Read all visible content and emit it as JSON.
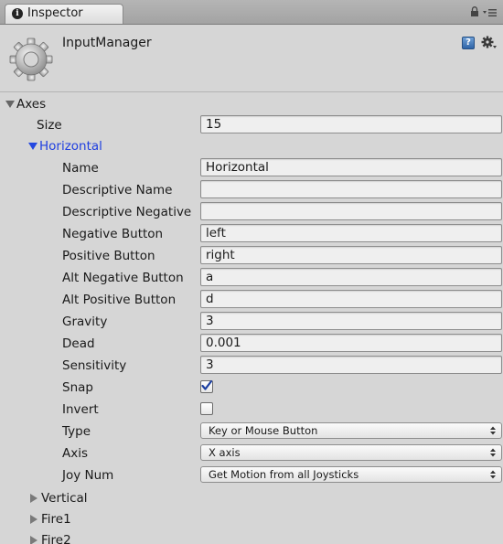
{
  "window": {
    "tab_title": "Inspector",
    "object_name": "InputManager"
  },
  "axes": {
    "label": "Axes",
    "size_label": "Size",
    "size_value": "15",
    "horizontal": {
      "label": "Horizontal",
      "fields": {
        "name": {
          "label": "Name",
          "value": "Horizontal"
        },
        "descriptive_name": {
          "label": "Descriptive Name",
          "value": ""
        },
        "descriptive_negative": {
          "label": "Descriptive Negative",
          "value": ""
        },
        "negative_button": {
          "label": "Negative Button",
          "value": "left"
        },
        "positive_button": {
          "label": "Positive Button",
          "value": "right"
        },
        "alt_negative_button": {
          "label": "Alt Negative Button",
          "value": "a"
        },
        "alt_positive_button": {
          "label": "Alt Positive Button",
          "value": "d"
        },
        "gravity": {
          "label": "Gravity",
          "value": "3"
        },
        "dead": {
          "label": "Dead",
          "value": "0.001"
        },
        "sensitivity": {
          "label": "Sensitivity",
          "value": "3"
        },
        "snap": {
          "label": "Snap",
          "checked": true
        },
        "invert": {
          "label": "Invert",
          "checked": false
        },
        "type": {
          "label": "Type",
          "value": "Key or Mouse Button"
        },
        "axis": {
          "label": "Axis",
          "value": "X axis"
        },
        "joy_num": {
          "label": "Joy Num",
          "value": "Get Motion from all Joysticks"
        }
      }
    },
    "collapsed": [
      "Vertical",
      "Fire1",
      "Fire2"
    ]
  },
  "colors": {
    "panel_bg": "#d6d6d6",
    "expanded_axis_text": "#1f3fe0",
    "field_bg": "#efefef",
    "checkmark": "#1c3fa0"
  },
  "icons": {
    "tab": "info-icon",
    "lock": "lock-icon",
    "menu": "tab-menu-icon",
    "component": "gear-icon",
    "help": "help-book-icon",
    "settings": "settings-gear-icon"
  }
}
